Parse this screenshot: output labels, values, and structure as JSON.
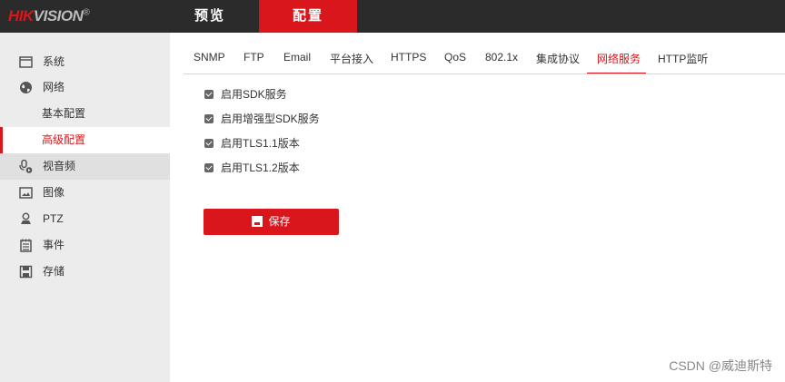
{
  "brand": {
    "name_red": "HIK",
    "name_gray": "VISION",
    "reg": "®"
  },
  "nav": {
    "preview": "预览",
    "config": "配置"
  },
  "sidebar": {
    "items": [
      {
        "label": "系统",
        "icon": "window-icon"
      },
      {
        "label": "网络",
        "icon": "globe-icon"
      },
      {
        "label": "基本配置"
      },
      {
        "label": "高级配置"
      },
      {
        "label": "视音频",
        "icon": "mic-icon"
      },
      {
        "label": "图像",
        "icon": "image-icon"
      },
      {
        "label": "PTZ",
        "icon": "ptz-icon"
      },
      {
        "label": "事件",
        "icon": "calendar-icon"
      },
      {
        "label": "存储",
        "icon": "floppy-icon"
      }
    ]
  },
  "tabs": [
    "SNMP",
    "FTP",
    "Email",
    "平台接入",
    "HTTPS",
    "QoS",
    "802.1x",
    "集成协议",
    "网络服务",
    "HTTP监听"
  ],
  "active_tab": "网络服务",
  "options": [
    {
      "label": "启用SDK服务",
      "checked": true
    },
    {
      "label": "启用增强型SDK服务",
      "checked": true
    },
    {
      "label": "启用TLS1.1版本",
      "checked": true
    },
    {
      "label": "启用TLS1.2版本",
      "checked": true
    }
  ],
  "save_label": "保存",
  "watermark": "CSDN @威迪斯特",
  "colors": {
    "accent": "#d9161c",
    "topbar": "#2b2b2b",
    "sidebar": "#ececec"
  }
}
